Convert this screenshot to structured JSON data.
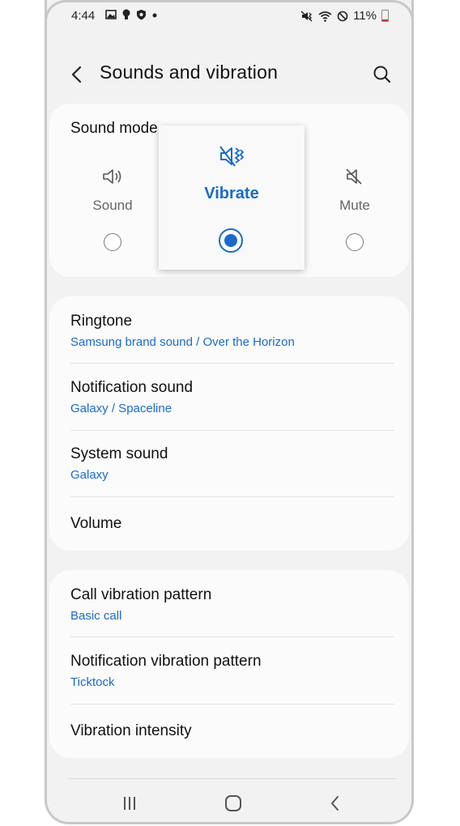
{
  "status_bar": {
    "time": "4:44",
    "left_icons": [
      "image-icon",
      "bulb-icon",
      "shield-icon",
      "dot-icon"
    ],
    "right_icons": [
      "vibrate-mode-icon",
      "wifi-icon",
      "dnd-icon"
    ],
    "battery_percent": "11%"
  },
  "app_bar": {
    "title": "Sounds and vibration",
    "back_icon": "chevron-left-icon",
    "search_icon": "search-icon"
  },
  "sound_mode": {
    "title": "Sound mode",
    "options": [
      {
        "label": "Sound",
        "icon": "speaker-icon",
        "selected": false
      },
      {
        "label": "Vibrate",
        "icon": "vibrate-icon",
        "selected": true
      },
      {
        "label": "Mute",
        "icon": "mute-icon",
        "selected": false
      }
    ]
  },
  "sound_settings": [
    {
      "title": "Ringtone",
      "subtitle": "Samsung brand sound / Over the Horizon"
    },
    {
      "title": "Notification sound",
      "subtitle": "Galaxy / Spaceline"
    },
    {
      "title": "System sound",
      "subtitle": "Galaxy"
    },
    {
      "title": "Volume",
      "subtitle": ""
    }
  ],
  "vibration_settings": [
    {
      "title": "Call vibration pattern",
      "subtitle": "Basic call"
    },
    {
      "title": "Notification vibration pattern",
      "subtitle": "Ticktock"
    },
    {
      "title": "Vibration intensity",
      "subtitle": ""
    }
  ],
  "nav_bar": {
    "icons": [
      "recents-icon",
      "home-icon",
      "back-icon"
    ]
  },
  "colors": {
    "accent": "#1b6ac9",
    "background": "#f2f2f2",
    "card": "#fbfbfb"
  }
}
